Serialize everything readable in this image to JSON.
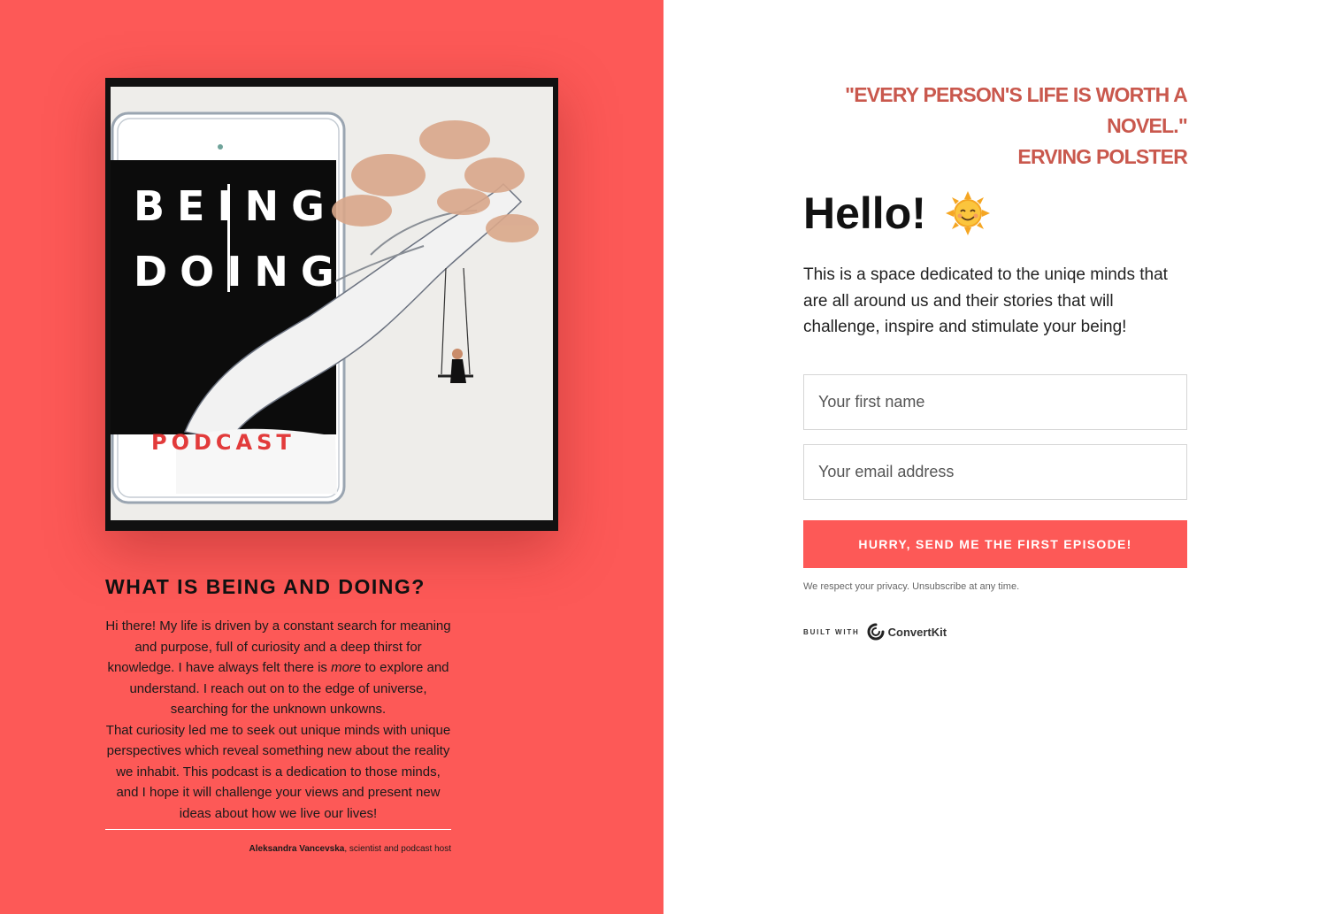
{
  "left": {
    "cover": {
      "title_line1": "BEING",
      "title_line2": "DOING",
      "subtitle": "PODCAST"
    },
    "section_title": "WHAT IS BEING AND DOING?",
    "about_part1": "Hi there! My life is driven by a constant search for meaning and purpose, full of curiosity and a deep thirst for knowledge. I have always felt there is ",
    "about_emph": "more",
    "about_part2": " to explore and understand. I reach out on to the edge of universe, searching for the unknown unkowns.",
    "about_para2": "That curiosity led me to seek out unique minds with unique perspectives which reveal something new about the reality we inhabit. This podcast is a dedication to those minds, and I hope it will challenge your views and present new ideas about how we live our lives!",
    "author_name": "Aleksandra Vancevska",
    "author_role": ", scientist and podcast host"
  },
  "right": {
    "quote_line1": "\"EVERY PERSON'S LIFE IS WORTH A",
    "quote_line2": "NOVEL.\"",
    "quote_author": "ERVING POLSTER",
    "greeting": "Hello!",
    "intro": "This is a space dedicated to the uniqe minds that are all around us and their stories that will challenge, inspire and stimulate your being!",
    "form": {
      "first_name_placeholder": "Your first name",
      "email_placeholder": "Your email address",
      "submit_label": "HURRY, SEND ME THE FIRST EPISODE!"
    },
    "privacy": "We respect your privacy. Unsubscribe at any time.",
    "built_with": "BUILT WITH",
    "built_with_brand": "ConvertKit"
  },
  "colors": {
    "coral": "#fd5957",
    "quote_red": "#c9584d"
  },
  "icons": [
    "smiling-sun-icon",
    "convertkit-logo-icon"
  ]
}
